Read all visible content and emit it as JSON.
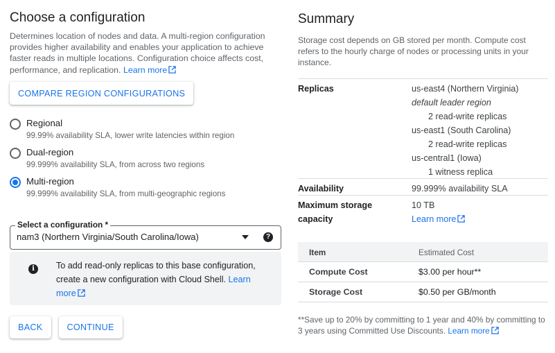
{
  "left": {
    "title": "Choose a configuration",
    "description": "Determines location of nodes and data. A multi-region configuration provides higher availability and enables your application to achieve faster reads in multiple locations. Configuration choice affects cost, performance, and replication.",
    "learn_more": "Learn more",
    "compare_button": "COMPARE REGION CONFIGURATIONS",
    "options": [
      {
        "label": "Regional",
        "sub": "99.99% availability SLA, lower write latencies within region",
        "checked": false
      },
      {
        "label": "Dual-region",
        "sub": "99.999% availability SLA, from across two regions",
        "checked": false
      },
      {
        "label": "Multi-region",
        "sub": "99.999% availability SLA, from multi-geographic regions",
        "checked": true
      }
    ],
    "select": {
      "label": "Select a configuration *",
      "value": "nam3 (Northern Virginia/South Carolina/Iowa)"
    },
    "info": {
      "text": "To add read-only replicas to this base configuration, create a new configuration with Cloud Shell.",
      "link": "Learn more"
    },
    "back_button": "BACK",
    "continue_button": "CONTINUE"
  },
  "summary": {
    "title": "Summary",
    "description": "Storage cost depends on GB stored per month. Compute cost refers to the hourly charge of nodes or processing units in your instance.",
    "replicas_key": "Replicas",
    "replicas": [
      "us-east4 (Northern Virginia)",
      "default leader region",
      "2 read-write replicas",
      "us-east1 (South Carolina)",
      "2 read-write replicas",
      "us-central1 (Iowa)",
      "1 witness replica"
    ],
    "availability_key": "Availability",
    "availability_value": "99.999% availability SLA",
    "storage_key_1": "Maximum storage",
    "storage_key_2": "capacity",
    "storage_value": "10 TB",
    "storage_link": "Learn more",
    "table": {
      "headers": [
        "Item",
        "Estimated Cost"
      ],
      "rows": [
        [
          "Compute Cost",
          "$3.00 per hour**"
        ],
        [
          "Storage Cost",
          "$0.50 per GB/month"
        ]
      ]
    },
    "footnote": "**Save up to 20% by committing to 1 year and 40% by committing to 3 years using Committed Use Discounts.",
    "footnote_link": "Learn more"
  }
}
